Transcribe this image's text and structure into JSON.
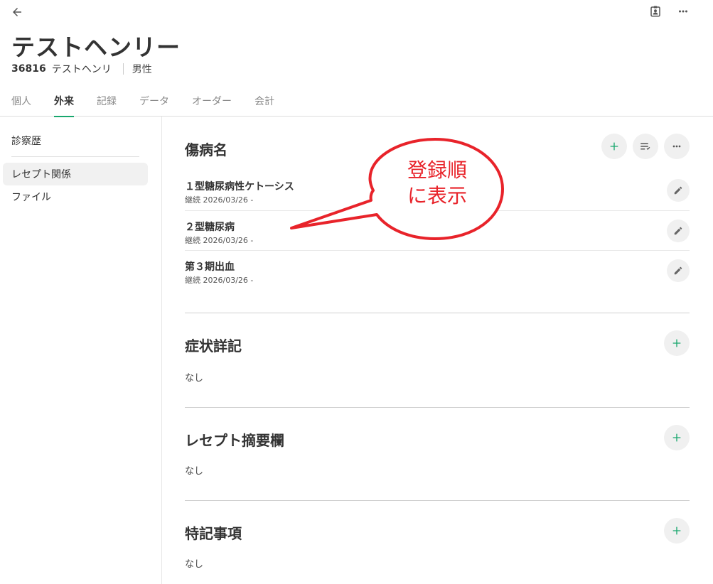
{
  "icons": {
    "back": "arrow-left-icon",
    "id_card": "contact-card-icon",
    "more": "more-horizontal-icon",
    "add": "plus-icon",
    "sort": "sort-list-icon",
    "edit": "pencil-icon"
  },
  "colors": {
    "accent": "#18a76e",
    "callout": "#e8232a"
  },
  "patient": {
    "name": "テストヘンリー",
    "id": "36816",
    "kana": "テストヘンリ",
    "sex": "男性"
  },
  "tabs": [
    {
      "label": "個人",
      "active": false
    },
    {
      "label": "外来",
      "active": true
    },
    {
      "label": "記録",
      "active": false
    },
    {
      "label": "データ",
      "active": false
    },
    {
      "label": "オーダー",
      "active": false
    },
    {
      "label": "会計",
      "active": false
    }
  ],
  "sidebar": {
    "title": "診察歴",
    "items": [
      {
        "label": "レセプト関係",
        "active": true
      },
      {
        "label": "ファイル",
        "active": false
      }
    ]
  },
  "sections": {
    "disease": {
      "title": "傷病名",
      "rows": [
        {
          "name": "１型糖尿病性ケトーシス",
          "meta": "継続 2026/03/26 -"
        },
        {
          "name": "２型糖尿病",
          "meta": "継続 2026/03/26 -"
        },
        {
          "name": "第３期出血",
          "meta": "継続 2026/03/26 -"
        }
      ]
    },
    "symptom": {
      "title": "症状詳記",
      "value": "なし"
    },
    "receipt_summary": {
      "title": "レセプト摘要欄",
      "value": "なし"
    },
    "special_notes": {
      "title": "特記事項",
      "value": "なし"
    }
  },
  "annotation": {
    "line1": "登録順",
    "line2": "に表示"
  }
}
